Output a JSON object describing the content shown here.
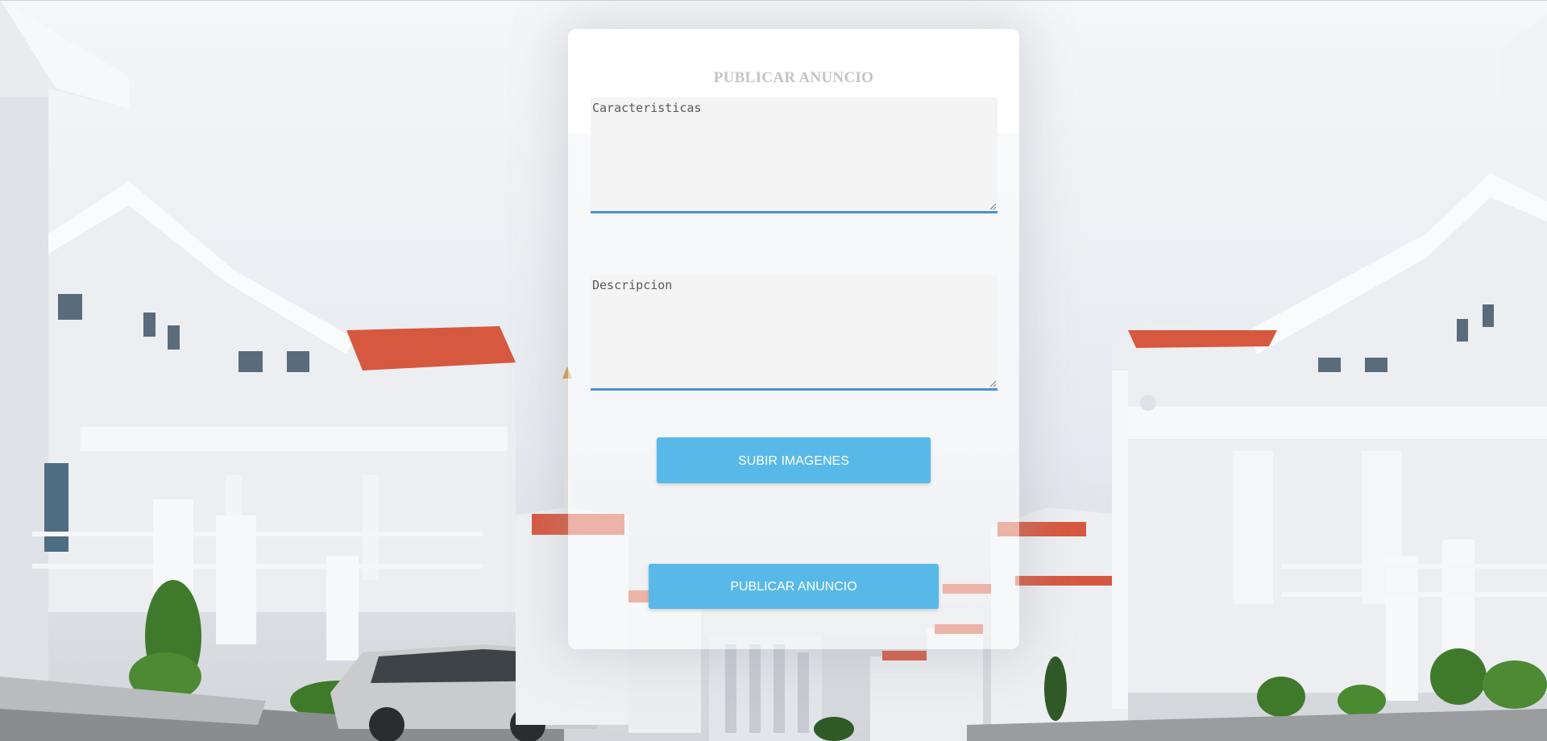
{
  "form": {
    "title": "PUBLICAR ANUNCIO",
    "features_placeholder": "Caracteristicas",
    "description_placeholder": "Descripcion",
    "upload_label": "SUBIR IMAGENES",
    "publish_label": "PUBLICAR ANUNCIO"
  },
  "colors": {
    "button": "#58b9e8",
    "field_underline": "#4a90d9",
    "title": "#c4c4c4",
    "roof": "#d9573f"
  }
}
